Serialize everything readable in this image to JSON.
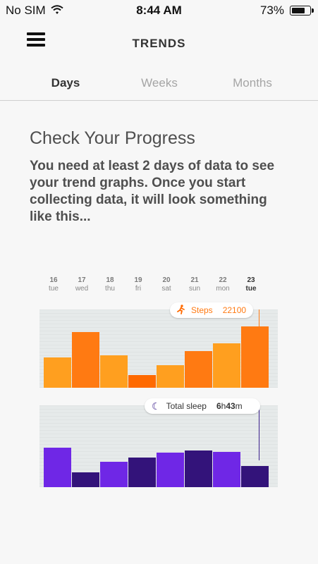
{
  "status": {
    "carrier": "No SIM",
    "time": "8:44 AM",
    "battery": "73%",
    "battery_level": 0.73
  },
  "nav": {
    "title": "TRENDS",
    "menu_icon": "hamburger-menu-icon"
  },
  "tabs": [
    {
      "label": "Days",
      "active": true
    },
    {
      "label": "Weeks",
      "active": false
    },
    {
      "label": "Months",
      "active": false
    }
  ],
  "content": {
    "heading": "Check Your Progress",
    "description": "You need at least 2 days of data to see your trend graphs. Once you start collecting data, it will look something like this..."
  },
  "preview": {
    "dates": [
      {
        "num": "16",
        "name": "tue"
      },
      {
        "num": "17",
        "name": "wed"
      },
      {
        "num": "18",
        "name": "thu"
      },
      {
        "num": "19",
        "name": "fri"
      },
      {
        "num": "20",
        "name": "sat"
      },
      {
        "num": "21",
        "name": "sun"
      },
      {
        "num": "22",
        "name": "mon"
      },
      {
        "num": "23",
        "name": "tue",
        "active": true
      }
    ],
    "steps": {
      "label": "Steps",
      "value": "22100",
      "icon": "running-person-icon",
      "color": "#ff7a12",
      "bars": [
        0.39,
        0.71,
        0.41,
        0.16,
        0.29,
        0.47,
        0.57,
        0.78
      ],
      "bar_colors": [
        "#ff9f1f",
        "#ff7a12",
        "#ff9f1f",
        "#ff6a00",
        "#ff9f1f",
        "#ff7a12",
        "#ff9f1f",
        "#ff7a12"
      ]
    },
    "sleep": {
      "label": "Total sleep",
      "hours": "6",
      "hours_unit": "h",
      "minutes": "43",
      "minutes_unit": "m",
      "icon": "moon-icon",
      "color": "#3b1f8c",
      "bars": [
        0.48,
        0.18,
        0.31,
        0.36,
        0.42,
        0.45,
        0.43,
        0.26
      ],
      "bar_colors": [
        "#6f27e6",
        "#33137a",
        "#6f27e6",
        "#33137a",
        "#6f27e6",
        "#33137a",
        "#6f27e6",
        "#33137a"
      ]
    }
  }
}
